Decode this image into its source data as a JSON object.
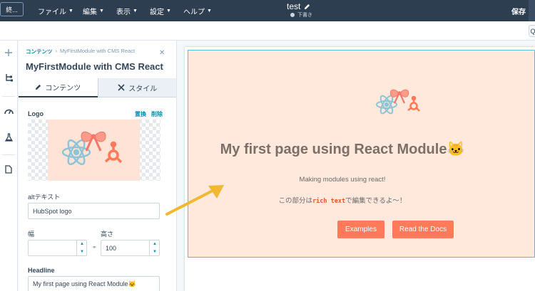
{
  "topbar": {
    "exit_label": "終...",
    "menus": [
      {
        "label": "ファイル"
      },
      {
        "label": "編集"
      },
      {
        "label": "表示"
      },
      {
        "label": "設定"
      },
      {
        "label": "ヘルプ"
      }
    ],
    "doc_title": "test",
    "doc_status": "下書き",
    "save_label": "保存",
    "toolbar_button_label": "Q"
  },
  "sidebar": {
    "breadcrumb_root": "コンテンツ",
    "breadcrumb_current": "MyFirstModule with CMS React",
    "module_title": "MyFirstModule with CMS React",
    "tabs": [
      {
        "label": "コンテンツ"
      },
      {
        "label": "スタイル"
      }
    ],
    "logo_label": "Logo",
    "logo_replace": "置換",
    "logo_delete": "削除",
    "alt_label": "altテキスト",
    "alt_value": "HubSpot logo",
    "width_label": "幅",
    "width_value": "",
    "height_label": "高さ",
    "height_value": "100",
    "headline_label": "Headline",
    "headline_value": "My first page using React Module🐱"
  },
  "preview": {
    "headline": "My first page using React Module🐱",
    "subtext": "Making modules using react!",
    "rich_prefix": "この部分は",
    "rich_code": "rich text",
    "rich_suffix": "で編集できるよ〜！",
    "buttons": [
      {
        "label": "Examples"
      },
      {
        "label": "Read the Docs"
      }
    ]
  },
  "colors": {
    "topbar": "#2d3e50",
    "accent": "#ff7a59",
    "link": "#0091ae",
    "module_bg": "#ffe8dc",
    "annotation_arrow": "#f2b830"
  }
}
